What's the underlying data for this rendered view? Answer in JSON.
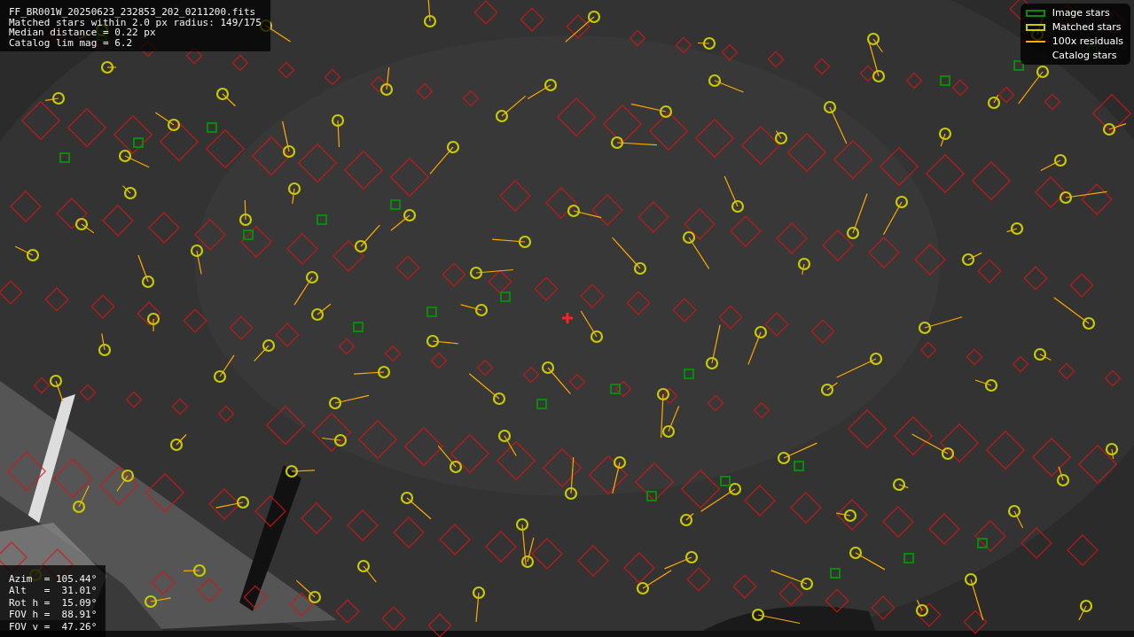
{
  "info_panel": {
    "lines": [
      "FF_BR001W_20250623_232853_202_0211200.fits",
      "Matched stars within 2.0 px radius: 149/175",
      "Median distance = 0.22 px",
      "Catalog lim mag = 6.2"
    ]
  },
  "legend": [
    {
      "kind": "green-box",
      "label": "Image stars"
    },
    {
      "kind": "yellow-box",
      "label": "Matched stars"
    },
    {
      "kind": "line",
      "label": "100x residuals"
    },
    {
      "kind": "blank",
      "label": "Catalog stars"
    }
  ],
  "pointing_panel": {
    "lines": [
      "Azim  = 105.44°",
      "Alt   =  31.01°",
      "Rot h =  15.09°",
      "FOV h =  88.91°",
      "FOV v =  47.26°"
    ]
  }
}
